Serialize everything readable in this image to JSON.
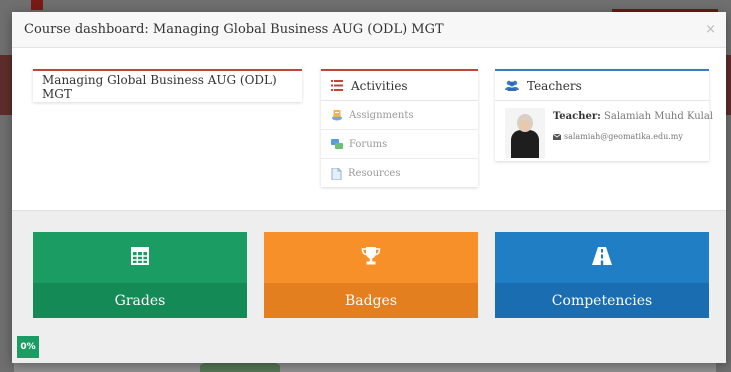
{
  "modal": {
    "title": "Course dashboard: Managing Global Business AUG (ODL) MGT",
    "close_symbol": "×"
  },
  "course": {
    "title": "Managing Global Business AUG (ODL) MGT"
  },
  "activities": {
    "heading": "Activities",
    "items": [
      {
        "label": "Assignments",
        "icon": "assignment-icon"
      },
      {
        "label": "Forums",
        "icon": "forum-icon"
      },
      {
        "label": "Resources",
        "icon": "resource-icon"
      }
    ]
  },
  "teachers": {
    "heading": "Teachers",
    "teacher_label": "Teacher:",
    "teacher_name": "Salamiah Muhd Kulal",
    "email": "salamiah@geomatika.edu.my"
  },
  "tiles": {
    "grades": "Grades",
    "badges": "Badges",
    "competencies": "Competencies"
  },
  "progress": {
    "text": "0%",
    "value": 0
  },
  "colors": {
    "grades": "#1a9c63",
    "badges": "#f8902a",
    "competencies": "#1f7ec4",
    "accent_red": "#c8423c",
    "accent_blue": "#3a7bc8"
  }
}
